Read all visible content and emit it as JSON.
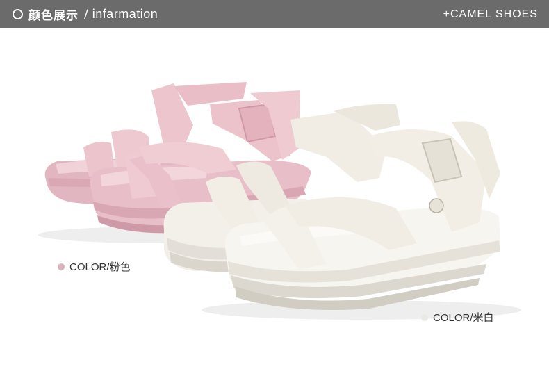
{
  "header": {
    "title_cn": "颜色展示",
    "separator": "/",
    "title_en": "infarmation",
    "brand": "+CAMEL SHOES"
  },
  "colors": [
    {
      "label": "COLOR/粉色",
      "swatch": "#d8b4bd"
    },
    {
      "label": "COLOR/米白",
      "swatch": "#ebe9e6"
    }
  ],
  "theme": {
    "banner": "#6b6b6b",
    "pink": "#e9c4cc",
    "cream": "#f4f0e8"
  }
}
